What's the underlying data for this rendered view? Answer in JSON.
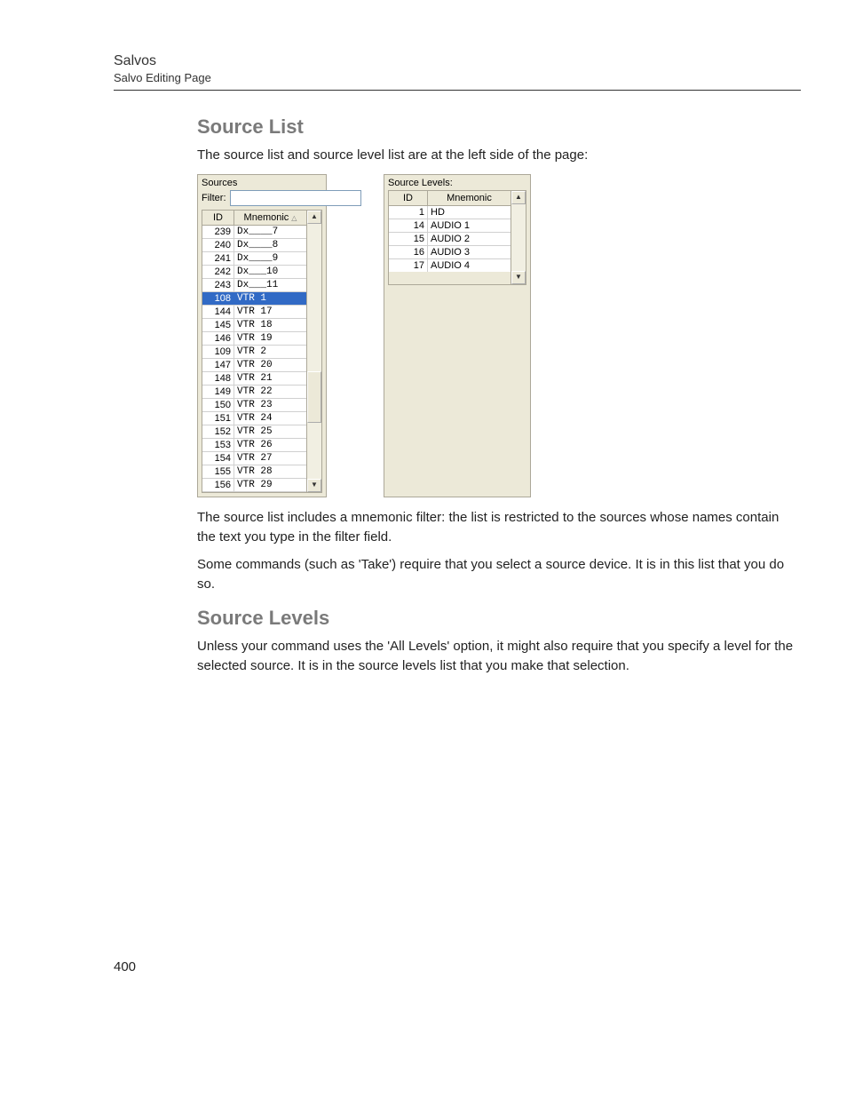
{
  "header": {
    "title": "Salvos",
    "subtitle": "Salvo Editing Page"
  },
  "section1": {
    "heading": "Source List",
    "intro": "The source list and source level list are at the left side of the page:",
    "para2": "The source list includes a mnemonic filter: the list is restricted to the sources whose names contain the text you type in the filter field.",
    "para3": "Some commands (such as 'Take') require that you select a source device. It is in this list that you do so."
  },
  "section2": {
    "heading": "Source Levels",
    "para1": "Unless your command uses the 'All Levels' option, it might also require that you specify a level for the selected source. It is in the source levels list that you make that selection."
  },
  "sources_panel": {
    "title": "Sources",
    "filter_label": "Filter:",
    "filter_value": "",
    "col_id": "ID",
    "col_mn": "Mnemonic",
    "rows": [
      {
        "id": "239",
        "mn": "Dx____7"
      },
      {
        "id": "240",
        "mn": "Dx____8"
      },
      {
        "id": "241",
        "mn": "Dx____9"
      },
      {
        "id": "242",
        "mn": "Dx___10"
      },
      {
        "id": "243",
        "mn": "Dx___11"
      },
      {
        "id": "108",
        "mn": "VTR 1",
        "selected": true
      },
      {
        "id": "144",
        "mn": "VTR 17"
      },
      {
        "id": "145",
        "mn": "VTR 18"
      },
      {
        "id": "146",
        "mn": "VTR 19"
      },
      {
        "id": "109",
        "mn": "VTR 2"
      },
      {
        "id": "147",
        "mn": "VTR 20"
      },
      {
        "id": "148",
        "mn": "VTR 21"
      },
      {
        "id": "149",
        "mn": "VTR 22"
      },
      {
        "id": "150",
        "mn": "VTR 23"
      },
      {
        "id": "151",
        "mn": "VTR 24"
      },
      {
        "id": "152",
        "mn": "VTR 25"
      },
      {
        "id": "153",
        "mn": "VTR 26"
      },
      {
        "id": "154",
        "mn": "VTR 27"
      },
      {
        "id": "155",
        "mn": "VTR 28"
      },
      {
        "id": "156",
        "mn": "VTR 29"
      }
    ]
  },
  "levels_panel": {
    "title": "Source Levels:",
    "col_id": "ID",
    "col_mn": "Mnemonic",
    "rows": [
      {
        "id": "1",
        "mn": "HD"
      },
      {
        "id": "14",
        "mn": "AUDIO 1"
      },
      {
        "id": "15",
        "mn": "AUDIO 2"
      },
      {
        "id": "16",
        "mn": "AUDIO 3"
      },
      {
        "id": "17",
        "mn": "AUDIO 4"
      }
    ]
  },
  "page_number": "400"
}
